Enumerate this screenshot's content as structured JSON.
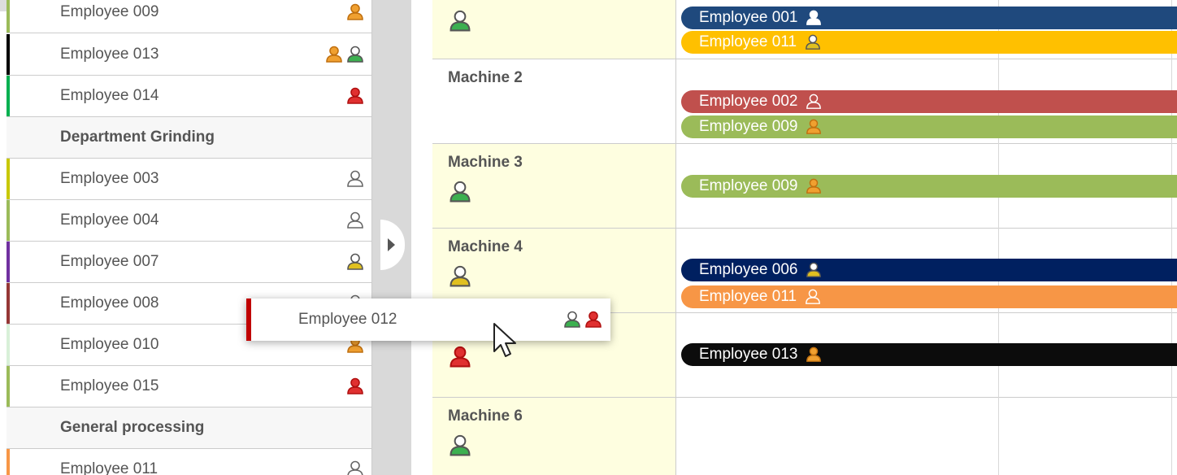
{
  "left_list": {
    "rows": [
      {
        "type": "employee",
        "name": "Employee 009",
        "color": "#9bbb59",
        "icons": [
          "orange"
        ]
      },
      {
        "type": "employee",
        "name": "Employee 013",
        "color": "#000000",
        "icons": [
          "orange",
          "green-outline"
        ]
      },
      {
        "type": "employee",
        "name": "Employee 014",
        "color": "#00b050",
        "icons": [
          "red"
        ]
      },
      {
        "type": "department",
        "name": "Department Grinding"
      },
      {
        "type": "employee",
        "name": "Employee 003",
        "color": "#c8c800",
        "icons": [
          "grey-outline"
        ]
      },
      {
        "type": "employee",
        "name": "Employee 004",
        "color": "#9bbb59",
        "icons": [
          "grey-outline"
        ]
      },
      {
        "type": "employee",
        "name": "Employee 007",
        "color": "#7030a0",
        "icons": [
          "yellow"
        ]
      },
      {
        "type": "employee",
        "name": "Employee 008",
        "color": "#953735",
        "icons": [
          "grey-outline"
        ]
      },
      {
        "type": "employee",
        "name": "Employee 010",
        "color": "#d8f0d8",
        "icons": [
          "orange"
        ]
      },
      {
        "type": "employee",
        "name": "Employee 015",
        "color": "#9bbb59",
        "icons": [
          "red"
        ]
      },
      {
        "type": "department",
        "name": "General processing"
      },
      {
        "type": "employee",
        "name": "Employee 011",
        "color": "#f79646",
        "icons": [
          "grey-outline"
        ]
      }
    ]
  },
  "machines": [
    {
      "name": "",
      "icon": "green",
      "bg": "yellow"
    },
    {
      "name": "Machine 2",
      "icon": "",
      "bg": "white"
    },
    {
      "name": "Machine 3",
      "icon": "green",
      "bg": "yellow"
    },
    {
      "name": "Machine 4",
      "icon": "yellow",
      "bg": "yellow"
    },
    {
      "name": "",
      "icon": "red",
      "bg": "yellow"
    },
    {
      "name": "Machine 6",
      "icon": "green",
      "bg": "yellow"
    }
  ],
  "assignments": [
    {
      "name": "Employee 001",
      "color": "#1f497d",
      "icon": "white"
    },
    {
      "name": "Employee 011",
      "color": "#ffc000",
      "icon": "yellow"
    },
    {
      "name": "Employee 002",
      "color": "#c0504d",
      "icon": "white-outline"
    },
    {
      "name": "Employee 009",
      "color": "#9bbb59",
      "icon": "orange"
    },
    {
      "name": "Employee 009",
      "color": "#9bbb59",
      "icon": "orange"
    },
    {
      "name": "Employee 006",
      "color": "#002060",
      "icon": "yellow"
    },
    {
      "name": "Employee 011",
      "color": "#f79646",
      "icon": "white-outline"
    },
    {
      "name": "Employee 013",
      "color": "#0c0c0c",
      "icon": "orange"
    }
  ],
  "drag_card": {
    "name": "Employee 012",
    "color": "#c00000",
    "icons": [
      "green-outline",
      "red"
    ]
  }
}
